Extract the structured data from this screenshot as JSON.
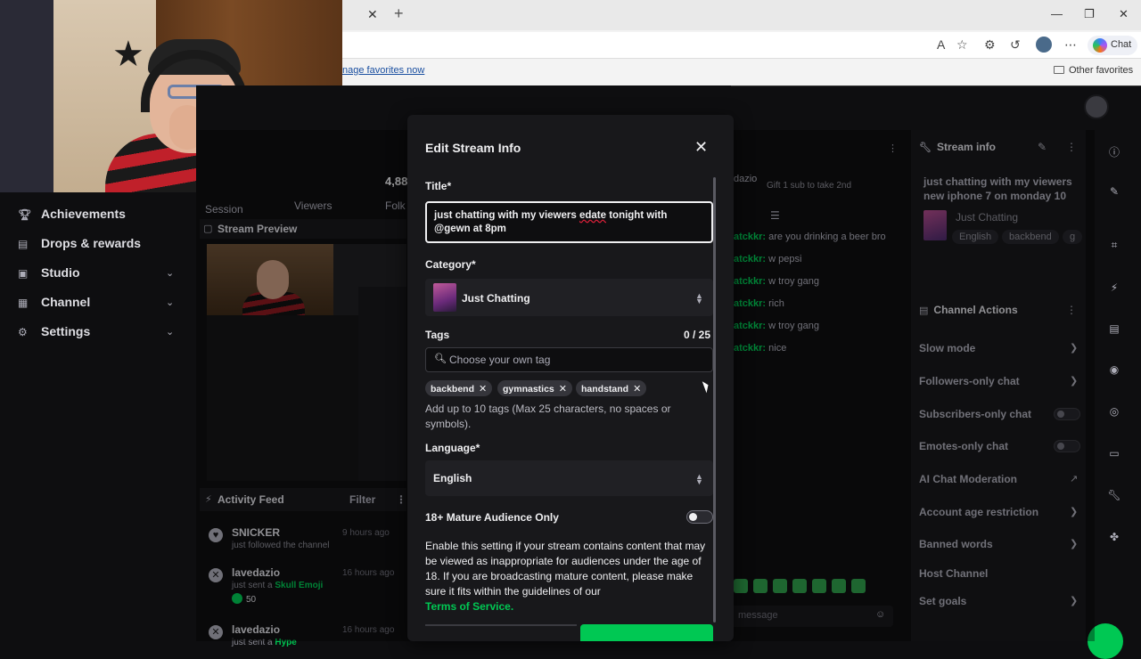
{
  "browser": {
    "tab_close": "✕",
    "tab_new": "+",
    "minimize": "—",
    "restore": "❐",
    "close": "✕",
    "favorites_link": "nage favorites now",
    "other_favorites": "Other favorites",
    "copilot_label": "Chat"
  },
  "left_nav": {
    "items": [
      {
        "label": "Achievements",
        "icon": "trophy-icon"
      },
      {
        "label": "Drops & rewards",
        "icon": "gift-icon"
      },
      {
        "label": "Studio",
        "icon": "studio-icon"
      },
      {
        "label": "Channel",
        "icon": "channel-icon"
      },
      {
        "label": "Settings",
        "icon": "gear-icon"
      }
    ]
  },
  "stats": {
    "viewers_value": "4,88",
    "session_label": "Session",
    "viewers_label": "Viewers",
    "follows_label": "Folk"
  },
  "preview": {
    "title": "Stream Preview"
  },
  "activity": {
    "title": "Activity Feed",
    "filter": "Filter",
    "items": [
      {
        "name": "SNICKER",
        "time": "9 hours ago",
        "desc": "just followed the channel"
      },
      {
        "name": "lavedazio",
        "time": "16 hours ago",
        "desc_prefix": "just sent a ",
        "desc_highlight": "Skull Emoji",
        "points": "50"
      },
      {
        "name": "lavedazio",
        "time": "16 hours ago",
        "desc_prefix": "just sent a ",
        "desc_highlight": "Hype"
      }
    ]
  },
  "chat": {
    "gift_text": "Gift 1 sub to take 2nd",
    "name_partial": "dazio",
    "lines": [
      {
        "user": "atckkr:",
        "text": "are you drinking a beer bro"
      },
      {
        "user": "atckkr:",
        "text": "w pepsi"
      },
      {
        "user": "atckkr:",
        "text": "w troy gang"
      },
      {
        "user": "atckkr:",
        "text": "rich"
      },
      {
        "user": "atckkr:",
        "text": "w troy gang"
      },
      {
        "user": "atckkr:",
        "text": "nice"
      }
    ],
    "input_placeholder": "message"
  },
  "stream_info": {
    "header": "Stream info",
    "title": "just chatting with my viewers new iphone 7 on monday 10",
    "category": "Just Chatting",
    "tags": [
      "English",
      "backbend",
      "g"
    ]
  },
  "channel_actions": {
    "header": "Channel Actions",
    "items": [
      {
        "label": "Slow mode",
        "control": "chevron"
      },
      {
        "label": "Followers-only chat",
        "control": "chevron"
      },
      {
        "label": "Subscribers-only chat",
        "control": "toggle"
      },
      {
        "label": "Emotes-only chat",
        "control": "toggle"
      },
      {
        "label": "AI Chat Moderation",
        "control": "external"
      },
      {
        "label": "Account age restriction",
        "control": "chevron"
      },
      {
        "label": "Banned words",
        "control": "chevron"
      },
      {
        "label": "Host Channel",
        "control": "none"
      },
      {
        "label": "Set goals",
        "control": "chevron"
      }
    ]
  },
  "modal": {
    "title": "Edit Stream Info",
    "title_label": "Title*",
    "title_value_part1": "just chatting with my viewers  ",
    "title_value_spell": "edate",
    "title_value_part2": " tonight with @gewn at 8pm",
    "category_label": "Category*",
    "category_value": "Just Chatting",
    "tags_label": "Tags",
    "tags_count": "0 / 25",
    "tags_placeholder": "Choose your own tag",
    "tags": [
      "backbend",
      "gymnastics",
      "handstand"
    ],
    "tags_helper": "Add up to 10 tags (Max 25 characters, no spaces or symbols).",
    "language_label": "Language*",
    "language_value": "English",
    "mature_label": "18+ Mature Audience Only",
    "mature_enabled": false,
    "mature_desc": "Enable this setting if your stream contains content that may be viewed as inappropriate for audiences under the age of 18. If you are broadcasting mature content, please make sure it fits within the guidelines of our",
    "tos_link": "Terms of Service."
  },
  "colors": {
    "accent_green": "#00c853",
    "background": "#0e0e10",
    "panel": "#18181b"
  }
}
